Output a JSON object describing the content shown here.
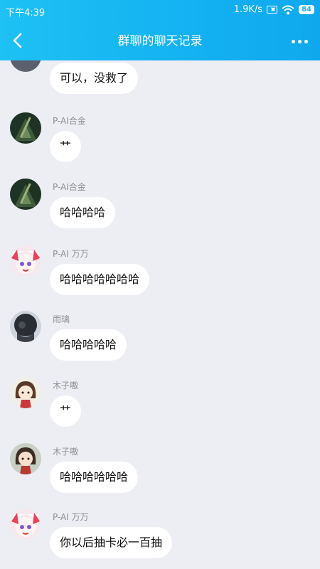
{
  "status": {
    "time": "下午4:39",
    "speed": "1.9K/s",
    "battery": "84"
  },
  "header": {
    "title": "群聊的聊天记录"
  },
  "messages": [
    {
      "sender": "",
      "text": "可以，没救了",
      "avatar": "dark"
    },
    {
      "sender": "P-AI合金",
      "text": "艹",
      "avatar": "green"
    },
    {
      "sender": "P-AI合金",
      "text": "哈哈哈哈",
      "avatar": "green"
    },
    {
      "sender": "P-AI 万万",
      "text": "哈哈哈哈哈哈哈",
      "avatar": "pink"
    },
    {
      "sender": "雨璃",
      "text": "哈哈哈哈哈",
      "avatar": "gray"
    },
    {
      "sender": "木子嗷",
      "text": "艹",
      "avatar": "anime"
    },
    {
      "sender": "木子嗷",
      "text": "哈哈哈哈哈哈",
      "avatar": "anime"
    },
    {
      "sender": "P-AI 万万",
      "text": "你以后抽卡必一百抽",
      "avatar": "pink"
    }
  ]
}
